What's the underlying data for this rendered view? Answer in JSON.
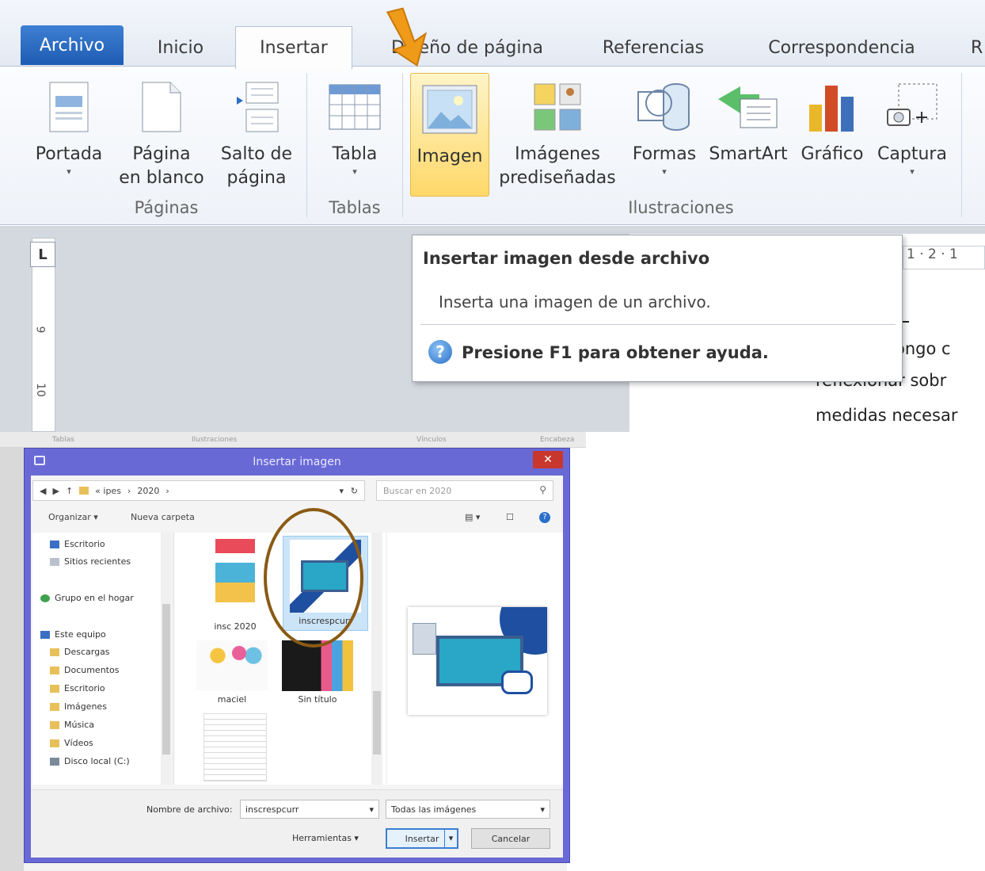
{
  "ribbon": {
    "tabs": {
      "archivo": "Archivo",
      "inicio": "Inicio",
      "insertar": "Insertar",
      "diseno": "Diseño de página",
      "referencias": "Referencias",
      "correspondencia": "Correspondencia",
      "more": "R"
    },
    "buttons": {
      "portada": "Portada",
      "pagina_en_blanco_1": "Página",
      "pagina_en_blanco_2": "en blanco",
      "salto_1": "Salto de",
      "salto_2": "página",
      "tabla": "Tabla",
      "imagen": "Imagen",
      "imagenes_1": "Imágenes",
      "imagenes_2": "prediseñadas",
      "formas": "Formas",
      "smartart": "SmartArt",
      "grafico": "Gráfico",
      "captura": "Captura",
      "dropdown_glyph": "▾"
    },
    "groups": {
      "paginas": "Páginas",
      "tablas": "Tablas",
      "ilustraciones": "Ilustraciones"
    },
    "colors": {
      "active_tab": "#fdfdfe",
      "archivo_tab": "#2b6cc4",
      "highlight": "#ffd869",
      "arrow": "#f09a1a"
    }
  },
  "tooltip": {
    "title": "Insertar imagen desde archivo",
    "description": "Inserta una imagen de un archivo.",
    "help": "Presione F1 para obtener ayuda.",
    "help_icon": "?"
  },
  "document": {
    "ruler_corner": "L",
    "ruler_numbers": [
      "9",
      "10"
    ],
    "hruler": "1 · 2 · 1",
    "lines": [
      "ongo c",
      "reflexionar  sobr",
      "medidas necesar"
    ]
  },
  "background_strip": [
    "Tablas",
    "Ilustraciones",
    "Vínculos",
    "Encabeza"
  ],
  "dialog": {
    "title": "Insertar imagen",
    "close": "✕",
    "address": [
      "«  ipes",
      "›",
      "2020",
      "›"
    ],
    "search_placeholder": "Buscar en 2020",
    "organize": "Organizar ▾",
    "new_folder": "Nueva carpeta",
    "nav_items": [
      "Escritorio",
      "Sitios recientes",
      "Grupo en el hogar",
      "Este equipo",
      "Descargas",
      "Documentos",
      "Escritorio",
      "Imágenes",
      "Música",
      "Vídeos",
      "Disco local (C:)"
    ],
    "files": [
      "insc 2020",
      "inscrespcurr",
      "maciel",
      "Sin título"
    ],
    "filename_label": "Nombre de archivo:",
    "filename_value": "inscrespcurr",
    "filter": "Todas las imágenes",
    "tools": "Herramientas ▾",
    "insert": "Insertar",
    "cancel": "Cancelar",
    "colors": {
      "frame": "#6969d6",
      "selection_circle": "#8a5a14"
    }
  }
}
